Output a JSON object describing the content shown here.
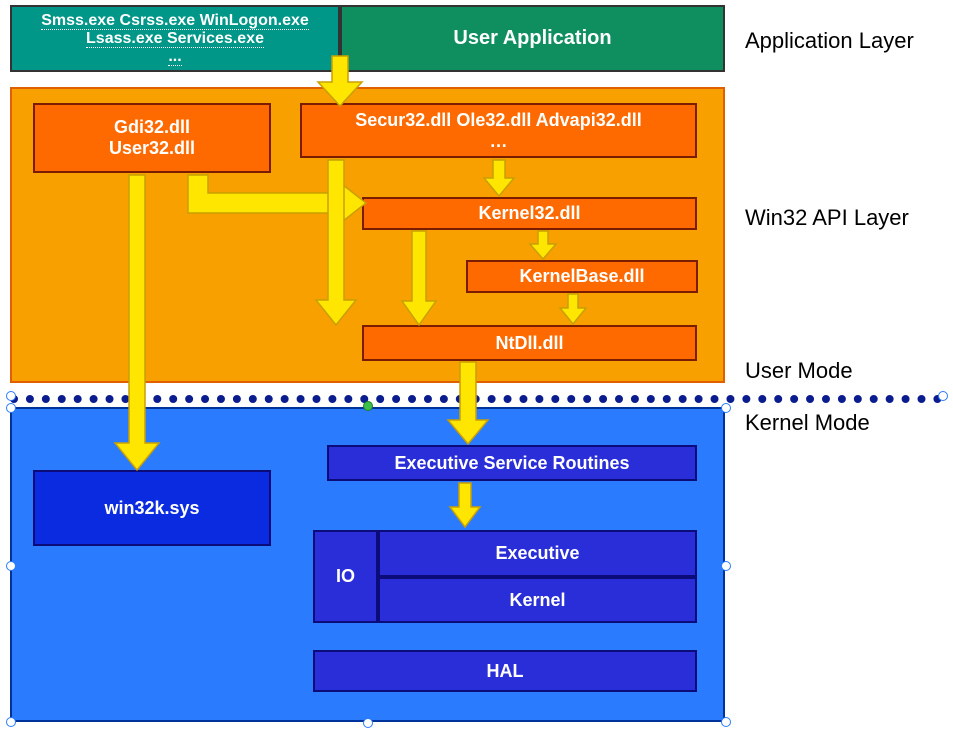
{
  "labels": {
    "application_layer": "Application Layer",
    "win32_api_layer": "Win32 API Layer",
    "user_mode": "User Mode",
    "kernel_mode": "Kernel Mode"
  },
  "app": {
    "sys_procs_line1": "Smss.exe Csrss.exe WinLogon.exe",
    "sys_procs_line2": "Lsass.exe Services.exe",
    "sys_procs_line3": "...",
    "user_app": "User Application"
  },
  "api": {
    "gdi_user_line1": "Gdi32.dll",
    "gdi_user_line2": "User32.dll",
    "secur_line1": "Secur32.dll Ole32.dll Advapi32.dll",
    "secur_line2": "…",
    "kernel32": "Kernel32.dll",
    "kernelbase": "KernelBase.dll",
    "ntdll": "NtDll.dll"
  },
  "kernel": {
    "win32k": "win32k.sys",
    "exec_svc": "Executive Service Routines",
    "io": "IO",
    "executive": "Executive",
    "kernel": "Kernel",
    "hal": "HAL"
  }
}
